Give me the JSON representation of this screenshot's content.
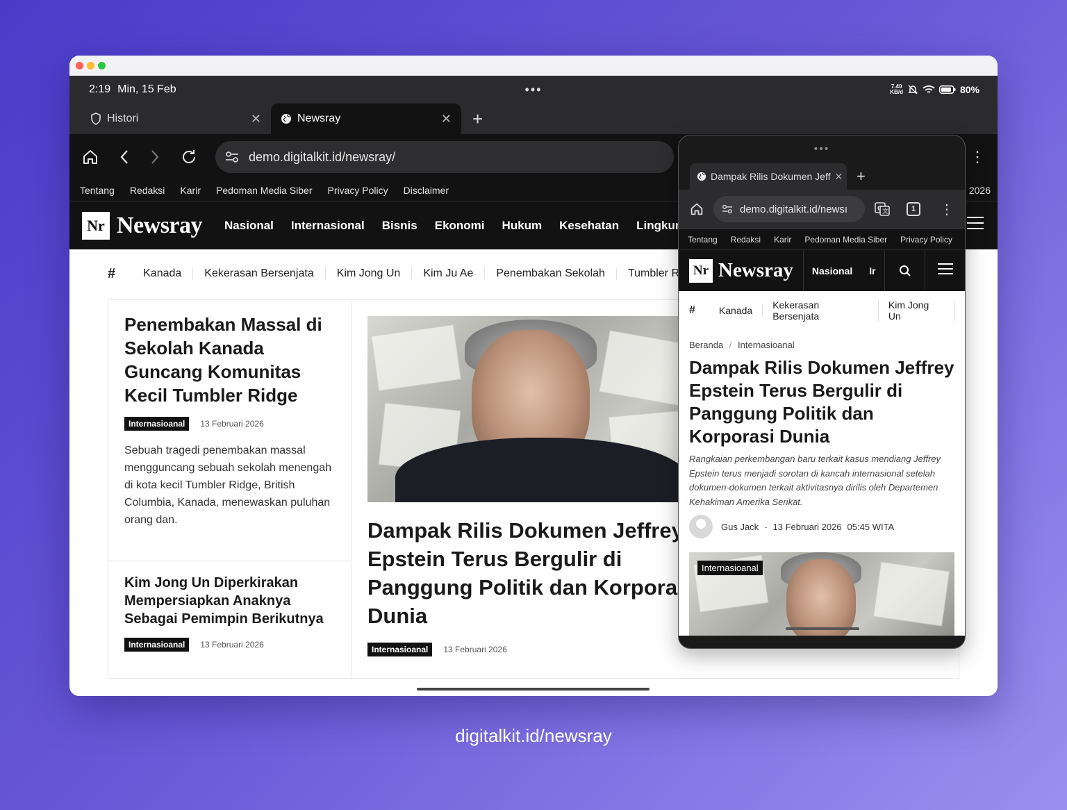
{
  "colors": {
    "background_start": "#4a3bc9",
    "background_end": "#9b8ff0",
    "dot_red": "#ff5f57",
    "dot_yellow": "#febc2e",
    "dot_green": "#28c840",
    "nav_bg": "#121212"
  },
  "status_bar": {
    "time": "2:19",
    "date": "Min, 15 Feb",
    "net_speed_top": "7.40",
    "net_speed_unit": "KB/d",
    "battery": "80%"
  },
  "browser_tabs": [
    {
      "label": "Histori",
      "icon": "shield-icon"
    },
    {
      "label": "Newsray",
      "icon": "globe-icon"
    }
  ],
  "address_bar": {
    "url": "demo.digitalkit.id/newsray/"
  },
  "top_nav": {
    "items": [
      "Tentang",
      "Redaksi",
      "Karir",
      "Pedoman Media Siber",
      "Privacy Policy",
      "Disclaimer"
    ],
    "date_fragment": "2026"
  },
  "site": {
    "logo_mark": "Nr",
    "logo_text": "Newsray",
    "menu": [
      "Nasional",
      "Internasional",
      "Bisnis",
      "Ekonomi",
      "Hukum",
      "Kesehatan",
      "Lingkunga"
    ]
  },
  "tags": {
    "symbol": "#",
    "items": [
      "Kanada",
      "Kekerasan Bersenjata",
      "Kim Jong Un",
      "Kim Ju Ae",
      "Penembakan Sekolah",
      "Tumbler R"
    ]
  },
  "articles": {
    "left_main": {
      "title": "Penembakan Massal di Sekolah Kanada Guncang Komunitas Kecil Tumbler Ridge",
      "category": "Internasioanal",
      "date": "13 Februari 2026",
      "excerpt": "Sebuah tragedi penembakan massal mengguncang sebuah sekolah menengah di kota kecil Tumbler Ridge, British Columbia, Kanada, menewaskan puluhan orang dan."
    },
    "left_second": {
      "title": "Kim Jong Un Diperkirakan Mempersiapkan Anaknya Sebagai Pemimpin Berikutnya",
      "category": "Internasioanal",
      "date": "13 Februari 2026"
    },
    "headline": {
      "title_line1": "Dampak Rilis Dokumen Jeffrey",
      "title_line2": "Epstein Terus Bergulir di",
      "title_line3": "Panggung Politik dan Korporasi",
      "title_line4": "Dunia",
      "category": "Internasioanal",
      "date": "13 Februari 2026"
    }
  },
  "mobile": {
    "handle": "•••",
    "tab_label": "Dampak Rilis Dokumen Jeff",
    "url": "demo.digitalkit.id/newsı",
    "tabs_count": "1",
    "top_nav": [
      "Tentang",
      "Redaksi",
      "Karir",
      "Pedoman Media Siber",
      "Privacy Policy"
    ],
    "menu": [
      "Nasional",
      "Ir"
    ],
    "tags": [
      "Kanada",
      "Kekerasan Bersenjata",
      "Kim Jong Un"
    ],
    "breadcrumb_home": "Beranda",
    "breadcrumb_sep": "/",
    "breadcrumb_section": "Internasioanal",
    "article_title": "Dampak Rilis Dokumen Jeffrey Epstein Terus Bergulir di Panggung Politik dan Korporasi Dunia",
    "article_lead": "Rangkaian perkembangan baru terkait kasus mendiang Jeffrey Epstein terus menjadi sorotan di kancah internasional setelah dokumen-dokumen terkait aktivitasnya dirilis oleh Departemen Kehakiman Amerika Serikat.",
    "author": "Gus Jack",
    "author_sep": "-",
    "published": "13 Februari 2026",
    "time": "05:45 WITA",
    "image_badge": "Internasioanal"
  },
  "caption": "digitalkit.id/newsray"
}
